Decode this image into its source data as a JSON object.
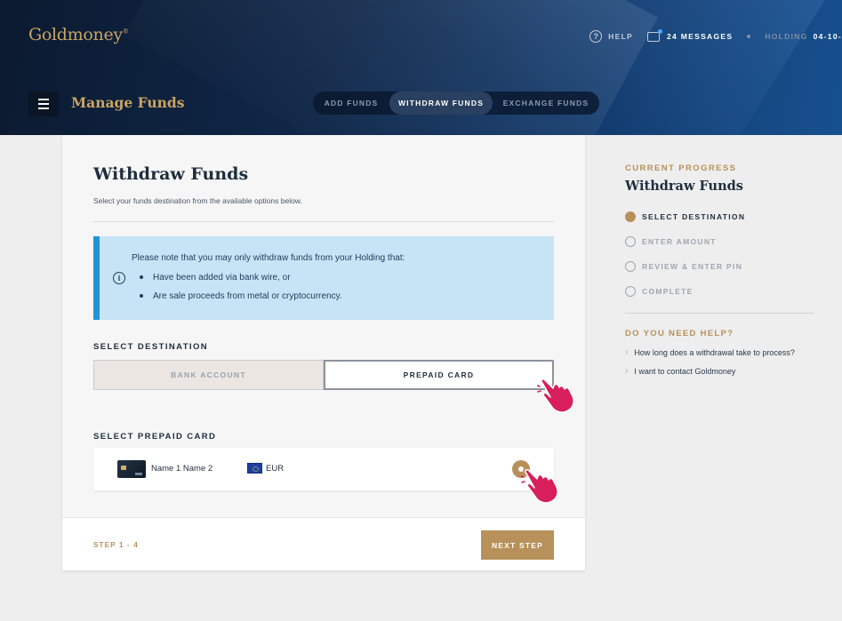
{
  "brand": {
    "logo": "Goldmoney",
    "mark": "®"
  },
  "topnav": {
    "help": "HELP",
    "messages": "24 MESSAGES",
    "holding_label": "HOLDING",
    "holding_value": "04-10-"
  },
  "subnav": {
    "page_title": "Manage Funds",
    "tabs": [
      {
        "label": "ADD FUNDS",
        "active": false
      },
      {
        "label": "WITHDRAW FUNDS",
        "active": true
      },
      {
        "label": "EXCHANGE FUNDS",
        "active": false
      }
    ]
  },
  "main": {
    "title": "Withdraw Funds",
    "subtitle": "Select your funds destination from the available options below.",
    "notice": {
      "intro": "Please note that you may only withdraw funds from your Holding that:",
      "bullets": [
        "Have been added via bank wire, or",
        "Are sale proceeds from metal or cryptocurrency."
      ]
    },
    "select_destination_label": "SELECT DESTINATION",
    "destination_options": [
      {
        "label": "BANK ACCOUNT",
        "selected": false
      },
      {
        "label": "PREPAID CARD",
        "selected": true
      }
    ],
    "select_card_label": "SELECT PREPAID CARD",
    "card": {
      "name": "Name 1 Name 2",
      "currency": "EUR",
      "selected": true
    },
    "footer": {
      "step": "STEP 1 - 4",
      "next": "NEXT STEP"
    }
  },
  "progress": {
    "label": "CURRENT PROGRESS",
    "title": "Withdraw Funds",
    "steps": [
      {
        "label": "SELECT DESTINATION",
        "active": true
      },
      {
        "label": "ENTER AMOUNT",
        "active": false
      },
      {
        "label": "REVIEW & ENTER PIN",
        "active": false
      },
      {
        "label": "COMPLETE",
        "active": false
      }
    ]
  },
  "help": {
    "label": "DO YOU NEED HELP?",
    "links": [
      "How long does a withdrawal take to process?",
      "I want to contact Goldmoney"
    ]
  },
  "colors": {
    "gold": "#b8915a",
    "navy": "#10284a",
    "notice_bg": "#c7e4f6",
    "notice_border": "#2393d8",
    "cursor": "#d81e5b"
  }
}
